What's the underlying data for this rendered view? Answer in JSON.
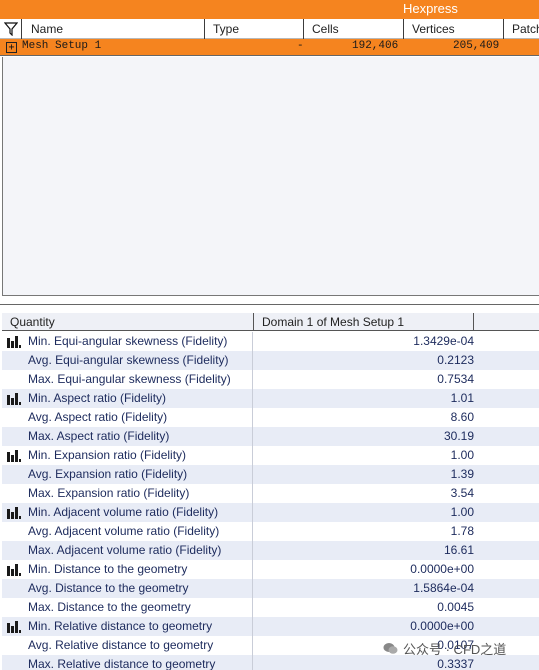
{
  "window": {
    "title": "Hexpress"
  },
  "mesh_table": {
    "columns": [
      "Name",
      "Type",
      "Cells",
      "Vertices",
      "Patch"
    ],
    "rows": [
      {
        "expand": "+",
        "name": "Mesh Setup 1",
        "type": "-",
        "cells": "192,406",
        "vertices": "205,409"
      }
    ]
  },
  "quality_table": {
    "columns": [
      "Quantity",
      "Domain 1 of Mesh Setup 1"
    ],
    "rows": [
      {
        "label": "Min. Equi-angular skewness (Fidelity)",
        "value": "1.3429e-04",
        "histogram": true
      },
      {
        "label": "Avg. Equi-angular skewness (Fidelity)",
        "value": "0.2123",
        "histogram": false
      },
      {
        "label": "Max. Equi-angular skewness (Fidelity)",
        "value": "0.7534",
        "histogram": false
      },
      {
        "label": "Min. Aspect ratio (Fidelity)",
        "value": "1.01",
        "histogram": true
      },
      {
        "label": "Avg. Aspect ratio (Fidelity)",
        "value": "8.60",
        "histogram": false
      },
      {
        "label": "Max. Aspect ratio (Fidelity)",
        "value": "30.19",
        "histogram": false
      },
      {
        "label": "Min. Expansion ratio (Fidelity)",
        "value": "1.00",
        "histogram": true
      },
      {
        "label": "Avg. Expansion ratio (Fidelity)",
        "value": "1.39",
        "histogram": false
      },
      {
        "label": "Max. Expansion ratio (Fidelity)",
        "value": "3.54",
        "histogram": false
      },
      {
        "label": "Min. Adjacent volume ratio (Fidelity)",
        "value": "1.00",
        "histogram": true
      },
      {
        "label": "Avg. Adjacent volume ratio (Fidelity)",
        "value": "1.78",
        "histogram": false
      },
      {
        "label": "Max. Adjacent volume ratio (Fidelity)",
        "value": "16.61",
        "histogram": false
      },
      {
        "label": "Min. Distance to the geometry",
        "value": "0.0000e+00",
        "histogram": true
      },
      {
        "label": "Avg. Distance to the geometry",
        "value": "1.5864e-04",
        "histogram": false
      },
      {
        "label": "Max. Distance to the geometry",
        "value": "0.0045",
        "histogram": false
      },
      {
        "label": "Min. Relative distance to geometry",
        "value": "0.0000e+00",
        "histogram": true
      },
      {
        "label": "Avg. Relative distance to geometry",
        "value": "0.0107",
        "histogram": false
      },
      {
        "label": "Max. Relative distance to geometry",
        "value": "0.3337",
        "histogram": false
      }
    ]
  },
  "watermark": {
    "text": "公众号 · CFD之道"
  },
  "colors": {
    "accent": "#f5841f",
    "row_alt": "#e8ecf6",
    "text": "#1c2a5c"
  }
}
